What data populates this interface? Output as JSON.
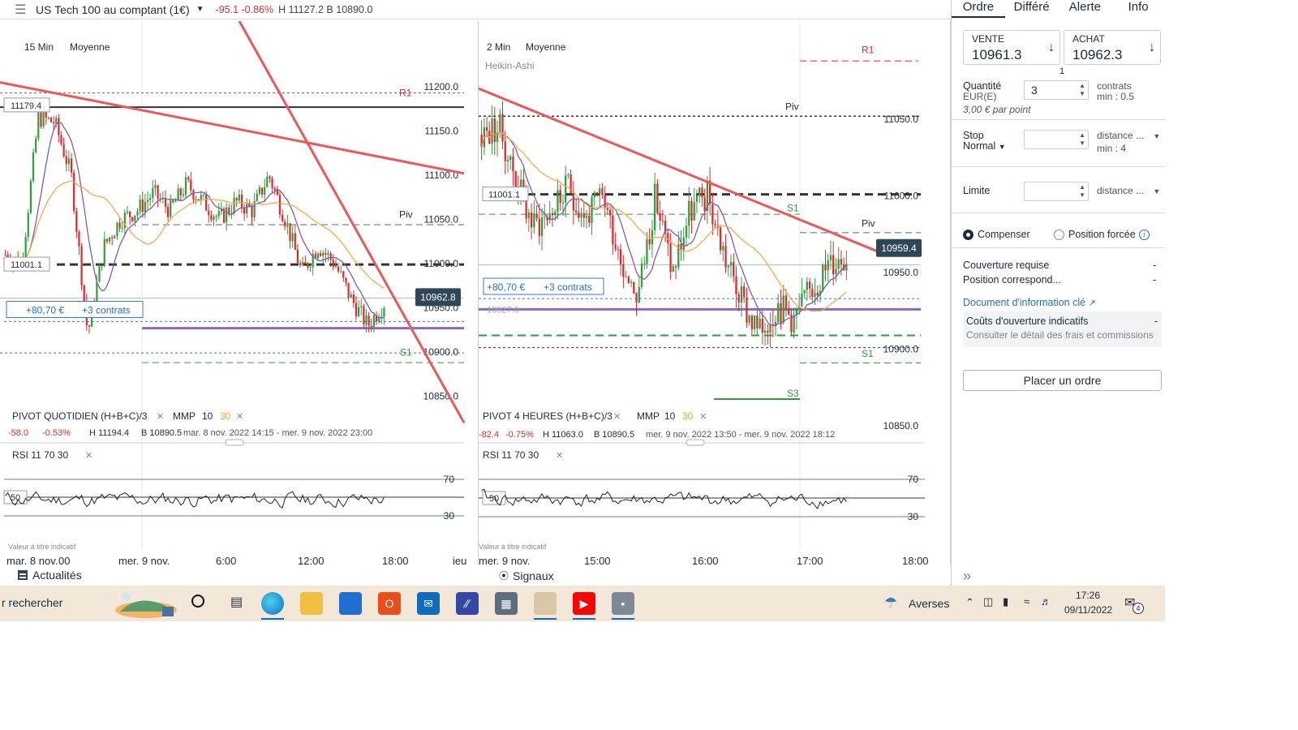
{
  "header": {
    "menu_icon": "hamburger-icon",
    "instrument": "US Tech 100 au comptant (1€)",
    "change": "-95.1  -0.86%",
    "high_low": "H 11127.2  B 10890.0"
  },
  "left_chart": {
    "interval": "15 Min",
    "style": "Moyenne",
    "y_labels": [
      "11200.0",
      "11150.0",
      "11100.0",
      "11050.0",
      "11000.0",
      "10950.0",
      "10900.0",
      "10850.0"
    ],
    "level_labels": {
      "r1": "R1",
      "piv": "Piv",
      "s1": "S1"
    },
    "tag_high": "11179.4",
    "tag_mid": "11001.1",
    "price_tag": "10962.8",
    "position_pl": "+80,70 €",
    "position_contracts": "+3 contrats",
    "pivot_legend": "PIVOT   QUOTIDIEN   (H+B+C)/3",
    "mmp_label": "MMP",
    "mmp_10": "10",
    "mmp_30": "30",
    "stats_change": "-58.0",
    "stats_pct": "-0.53%",
    "stats_high": "H 11194.4",
    "stats_low": "B 10890.5",
    "stats_range": "mar. 8 nov. 2022 14:15 - mer. 9 nov. 2022 23:00",
    "rsi_legend": "RSI   11   70   30",
    "rsi_levels": [
      "70",
      "50",
      "30"
    ],
    "disclaimer": "Valeur à titre indicatif",
    "x_labels": [
      "mar. 8 nov.",
      "00",
      "mer. 9 nov.",
      "6:00",
      "12:00",
      "18:00",
      "jeu"
    ]
  },
  "right_chart": {
    "interval": "2 Min",
    "style": "Moyenne",
    "sub_style": "Heikin-Ashi",
    "y_labels": [
      "11050.0",
      "11000.0",
      "10950.0",
      "10900.0",
      "10850.0"
    ],
    "level_labels": {
      "r1": "R1",
      "piv": "Piv",
      "s1a": "S1",
      "s1b": "S1",
      "s3": "S3"
    },
    "tag_mid": "11001.1",
    "price_tag": "10959.4",
    "position_pl": "+80,70 €",
    "position_contracts": "+3 contrats",
    "hidden_tag": "10927.0",
    "pivot_legend": "PIVOT   4 HEURES   (H+B+C)/3",
    "mmp_label": "MMP",
    "mmp_10": "10",
    "mmp_30": "30",
    "stats_change": "-82.4",
    "stats_pct": "-0.75%",
    "stats_high": "H 11063.0",
    "stats_low": "B 10890.5",
    "stats_range": "mer. 9 nov. 2022 13:50 - mer. 9 nov. 2022 18:12",
    "rsi_legend": "RSI   11   70   30",
    "rsi_levels": [
      "70",
      "50",
      "30"
    ],
    "disclaimer": "Valeur à titre indicatif",
    "x_labels": [
      "mer. 9 nov.",
      "15:00",
      "16:00",
      "17:00",
      "18:00"
    ]
  },
  "order_panel": {
    "tabs": [
      "Ordre",
      "Différé",
      "Alerte",
      "Info"
    ],
    "sell_label": "VENTE",
    "sell_price": "10961.3",
    "buy_label": "ACHAT",
    "buy_price": "10962.3",
    "spread": "1",
    "quantity_label": "Quantité",
    "quantity_unit": "EUR(E)",
    "quantity_value": "3",
    "quantity_hint": "contrats",
    "quantity_min": "min : 0.5",
    "per_point": "3,00 € par point",
    "stop_label": "Stop",
    "stop_type": "Normal",
    "stop_mode": "distance ...",
    "stop_min": "min : 4",
    "limit_label": "Limite",
    "limit_mode": "distance ...",
    "radio_compensate": "Compenser",
    "radio_forced": "Position forcée",
    "cover_label": "Couverture requise",
    "cover_value": "-",
    "position_label": "Position correspond...",
    "position_value": "-",
    "doc_link": "Document d'information clé",
    "costs_label": "Coûts d'ouverture indicatifs",
    "costs_value": "-",
    "costs_hint": "Consulter le détail des frais et commissions",
    "place_order": "Placer un ordre"
  },
  "bottom_bar": {
    "news_label": "Actualités",
    "signals_label": "Signaux"
  },
  "taskbar": {
    "search_text": "r rechercher",
    "weather_text": "Averses",
    "time": "17:26",
    "date": "09/11/2022",
    "notif_count": "4"
  },
  "colors": {
    "bull": "#2e9e3a",
    "bear": "#e3262c",
    "trendline": "#e85a5a",
    "ma_fast": "#7a5ea8",
    "ma_slow": "#f2a640",
    "rsi": "#222222",
    "tag_bg": "#2f4658"
  }
}
